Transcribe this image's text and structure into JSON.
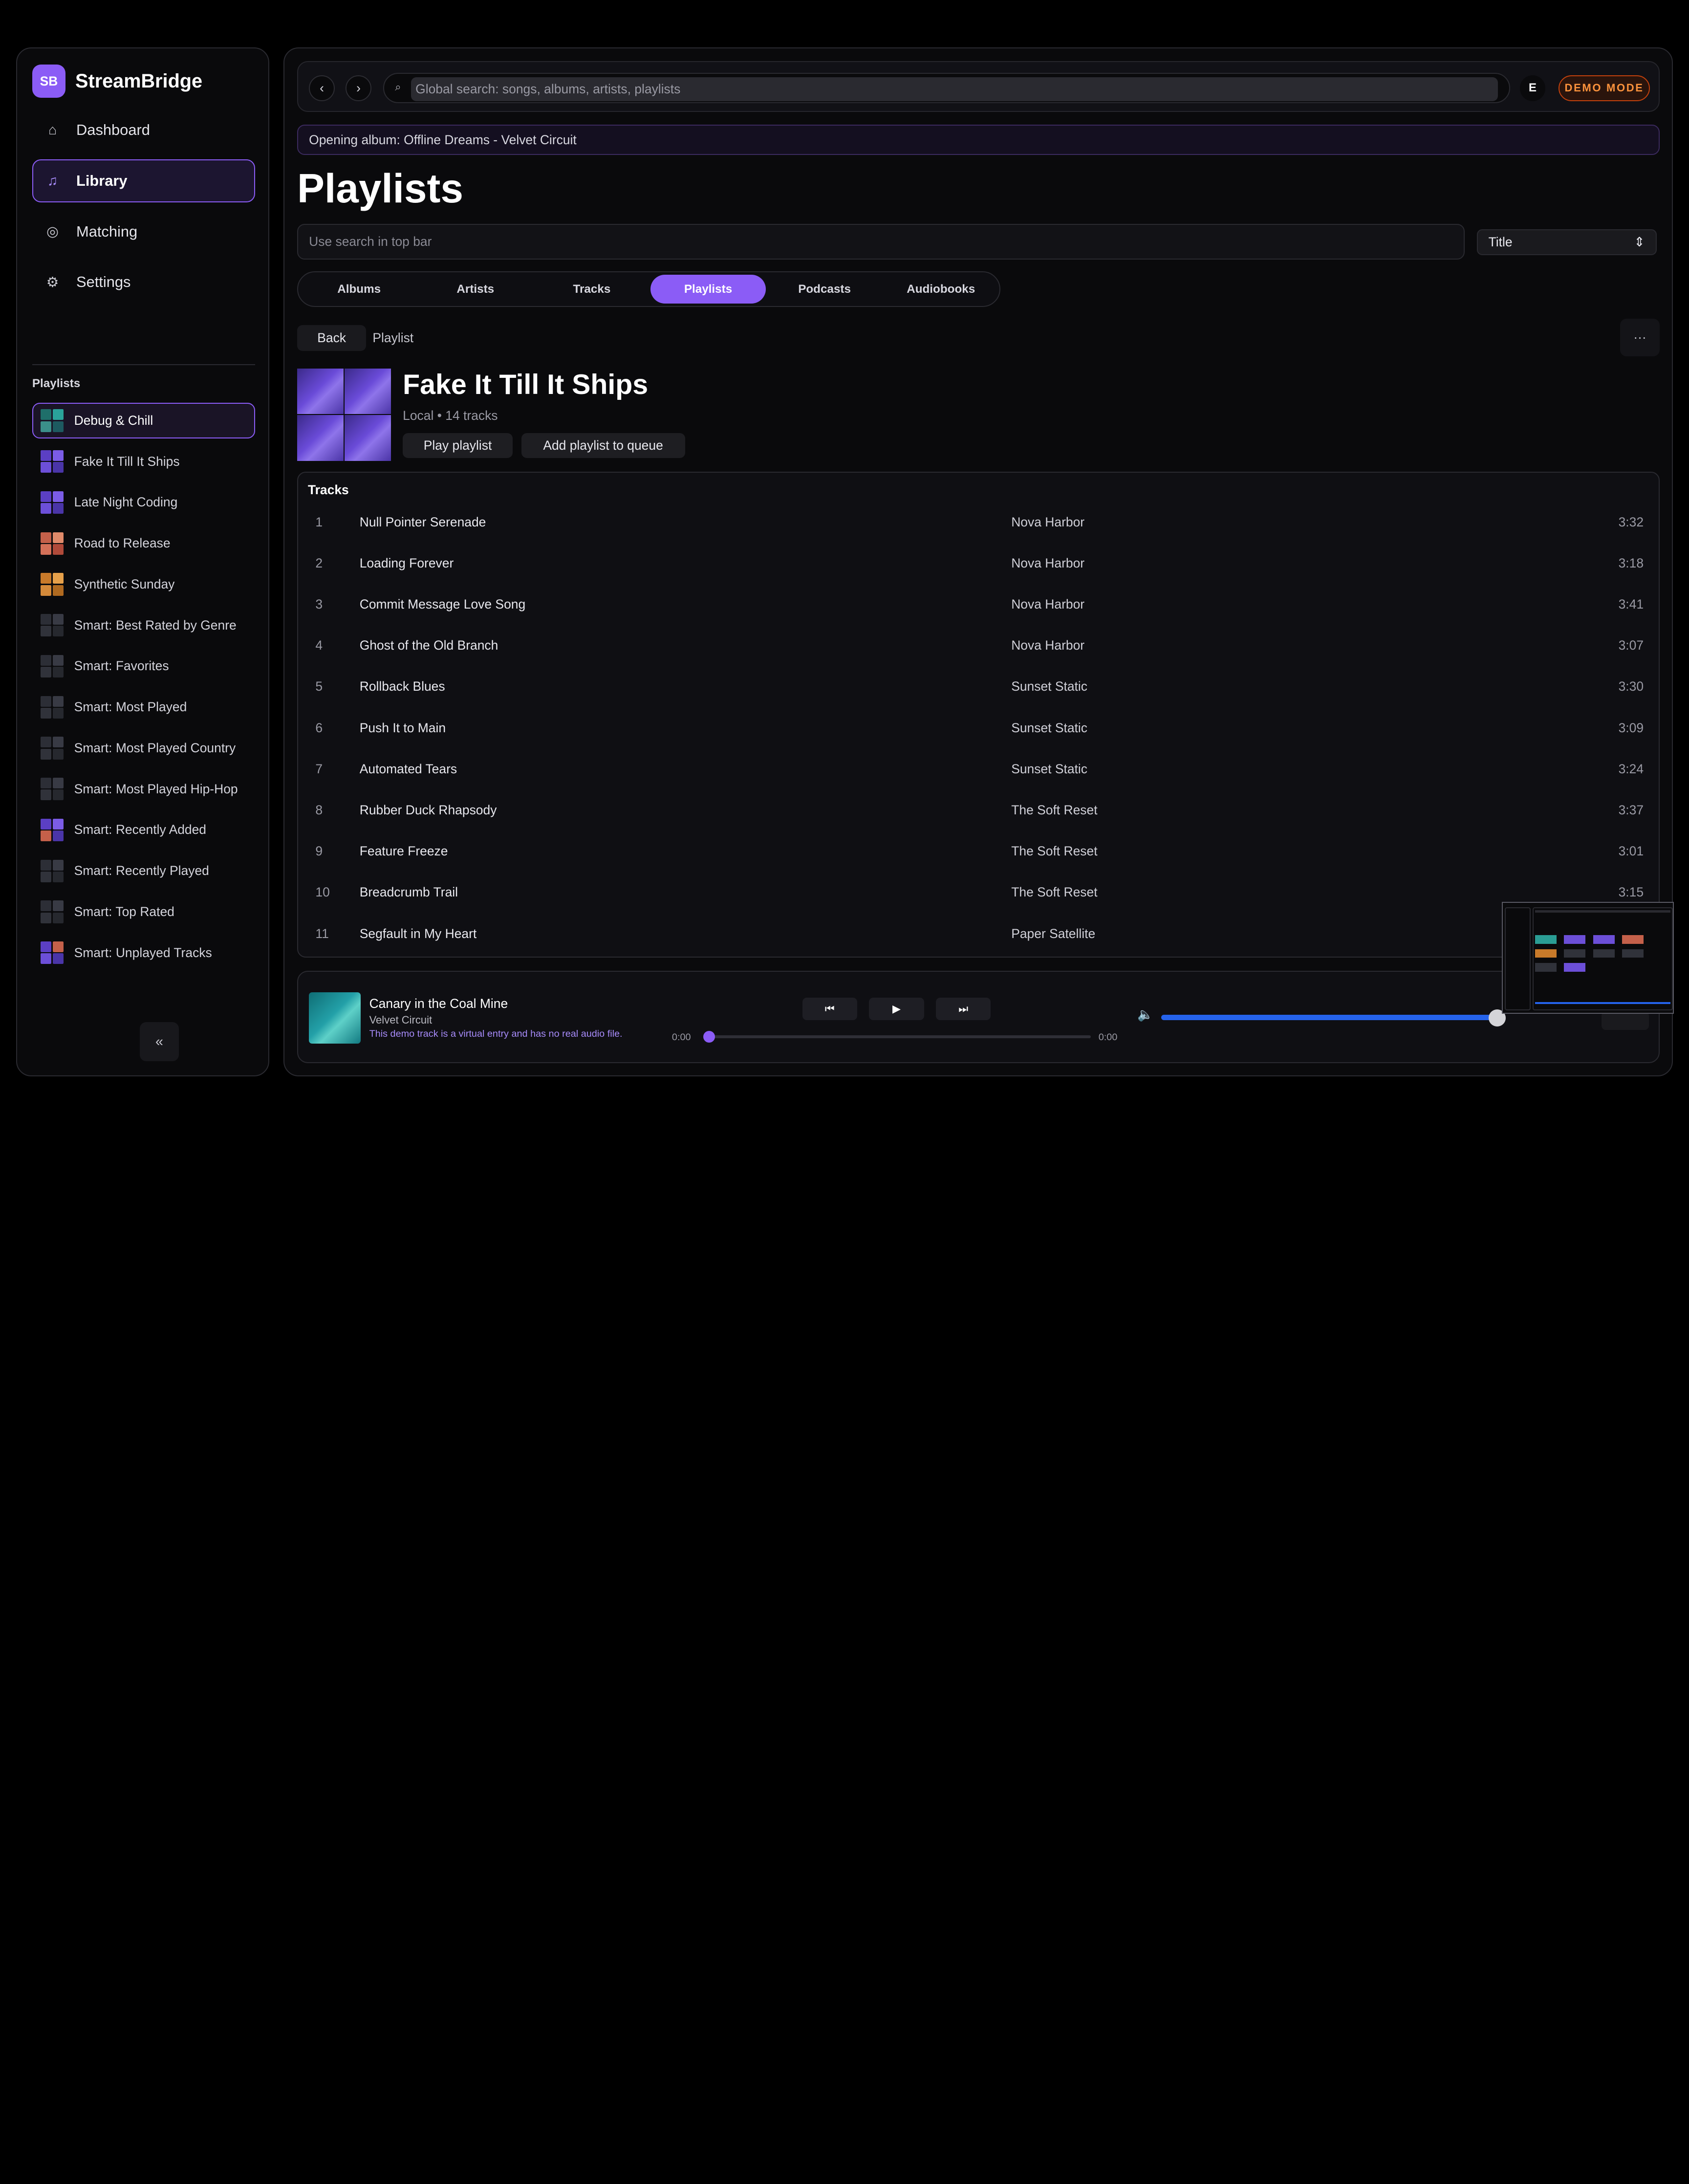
{
  "app": {
    "brand_initials": "SB",
    "brand_name": "StreamBridge",
    "accent": "#8b5cf6"
  },
  "nav": [
    {
      "label": "Dashboard",
      "icon": "home-icon",
      "active": false
    },
    {
      "label": "Library",
      "icon": "music-note-icon",
      "active": true
    },
    {
      "label": "Matching",
      "icon": "target-icon",
      "active": false
    },
    {
      "label": "Settings",
      "icon": "gear-icon",
      "active": false
    }
  ],
  "sidebar": {
    "playlists_heading": "Playlists",
    "collapse_label": "«",
    "playlists": [
      {
        "label": "Debug & Chill",
        "active": true,
        "colors": [
          "#1f6f6a",
          "#2aa39a",
          "#3b8f8a",
          "#1d5a60"
        ]
      },
      {
        "label": "Fake It Till It Ships",
        "active": false,
        "colors": [
          "#5b3fc4",
          "#7b5ce6",
          "#6c4fd8",
          "#4a35a8"
        ]
      },
      {
        "label": "Late Night Coding",
        "active": false,
        "colors": [
          "#5b3fc4",
          "#7b5ce6",
          "#6c4fd8",
          "#4a35a8"
        ]
      },
      {
        "label": "Road to Release",
        "active": false,
        "colors": [
          "#c4604a",
          "#e08a6a",
          "#d47058",
          "#b04a3a"
        ]
      },
      {
        "label": "Synthetic Sunday",
        "active": false,
        "colors": [
          "#c87a2a",
          "#e6a04a",
          "#d48a3a",
          "#b06a20"
        ]
      },
      {
        "label": "Smart: Best Rated by Genre",
        "active": false,
        "colors": [
          "#2c2e36",
          "#383a44",
          "#30323a",
          "#26282e"
        ]
      },
      {
        "label": "Smart: Favorites",
        "active": false,
        "colors": [
          "#2c2e36",
          "#383a44",
          "#30323a",
          "#26282e"
        ]
      },
      {
        "label": "Smart: Most Played",
        "active": false,
        "colors": [
          "#2c2e36",
          "#383a44",
          "#30323a",
          "#26282e"
        ]
      },
      {
        "label": "Smart: Most Played Country",
        "active": false,
        "colors": [
          "#2c2e36",
          "#383a44",
          "#30323a",
          "#26282e"
        ]
      },
      {
        "label": "Smart: Most Played Hip-Hop",
        "active": false,
        "colors": [
          "#2c2e36",
          "#383a44",
          "#30323a",
          "#26282e"
        ]
      },
      {
        "label": "Smart: Recently Added",
        "active": false,
        "colors": [
          "#5b3fc4",
          "#7b5ce6",
          "#c4604a",
          "#4a35a8"
        ]
      },
      {
        "label": "Smart: Recently Played",
        "active": false,
        "colors": [
          "#2c2e36",
          "#383a44",
          "#30323a",
          "#26282e"
        ]
      },
      {
        "label": "Smart: Top Rated",
        "active": false,
        "colors": [
          "#2c2e36",
          "#383a44",
          "#30323a",
          "#26282e"
        ]
      },
      {
        "label": "Smart: Unplayed Tracks",
        "active": false,
        "colors": [
          "#5b3fc4",
          "#c4604a",
          "#6c4fd8",
          "#4a35a8"
        ]
      }
    ]
  },
  "topbar": {
    "back_label": "‹",
    "forward_label": "›",
    "search_icon": "⌕",
    "search_placeholder": "Global search: songs, albums, artists, playlists",
    "user_initial": "E",
    "demo_label": "DEMO MODE"
  },
  "status_message": "Opening album: Offline Dreams - Velvet Circuit",
  "page": {
    "title": "Playlists",
    "filter_placeholder": "Use search in top bar",
    "sort_value": "Title",
    "sort_icon": "⇕",
    "tabs": [
      {
        "label": "Albums",
        "active": false
      },
      {
        "label": "Artists",
        "active": false
      },
      {
        "label": "Tracks",
        "active": false
      },
      {
        "label": "Playlists",
        "active": true
      },
      {
        "label": "Podcasts",
        "active": false
      },
      {
        "label": "Audiobooks",
        "active": false
      }
    ],
    "back_button": "Back",
    "breadcrumb": "Playlist",
    "more_label": "···"
  },
  "playlist": {
    "title": "Fake It Till It Ships",
    "meta": "Local • 14 tracks",
    "play_label": "Play playlist",
    "queue_label": "Add playlist to queue"
  },
  "tracks": {
    "heading": "Tracks",
    "rows": [
      {
        "num": "1",
        "title": "Null Pointer Serenade",
        "artist": "Nova Harbor",
        "duration": "3:32"
      },
      {
        "num": "2",
        "title": "Loading Forever",
        "artist": "Nova Harbor",
        "duration": "3:18"
      },
      {
        "num": "3",
        "title": "Commit Message Love Song",
        "artist": "Nova Harbor",
        "duration": "3:41"
      },
      {
        "num": "4",
        "title": "Ghost of the Old Branch",
        "artist": "Nova Harbor",
        "duration": "3:07"
      },
      {
        "num": "5",
        "title": "Rollback Blues",
        "artist": "Sunset Static",
        "duration": "3:30"
      },
      {
        "num": "6",
        "title": "Push It to Main",
        "artist": "Sunset Static",
        "duration": "3:09"
      },
      {
        "num": "7",
        "title": "Automated Tears",
        "artist": "Sunset Static",
        "duration": "3:24"
      },
      {
        "num": "8",
        "title": "Rubber Duck Rhapsody",
        "artist": "The Soft Reset",
        "duration": "3:37"
      },
      {
        "num": "9",
        "title": "Feature Freeze",
        "artist": "The Soft Reset",
        "duration": "3:01"
      },
      {
        "num": "10",
        "title": "Breadcrumb Trail",
        "artist": "The Soft Reset",
        "duration": "3:15"
      },
      {
        "num": "11",
        "title": "Segfault in My Heart",
        "artist": "Paper Satellite",
        "duration": ""
      }
    ]
  },
  "player": {
    "title": "Canary in the Coal Mine",
    "artist": "Velvet Circuit",
    "note": "This demo track is a virtual entry and has no real audio file.",
    "prev_icon": "⏮",
    "play_icon": "▶",
    "next_icon": "⏭",
    "time_elapsed": "0:00",
    "time_total": "0:00",
    "seek_fraction": 0.0,
    "volume_icon": "🔈",
    "volume_fraction": 1.0
  }
}
